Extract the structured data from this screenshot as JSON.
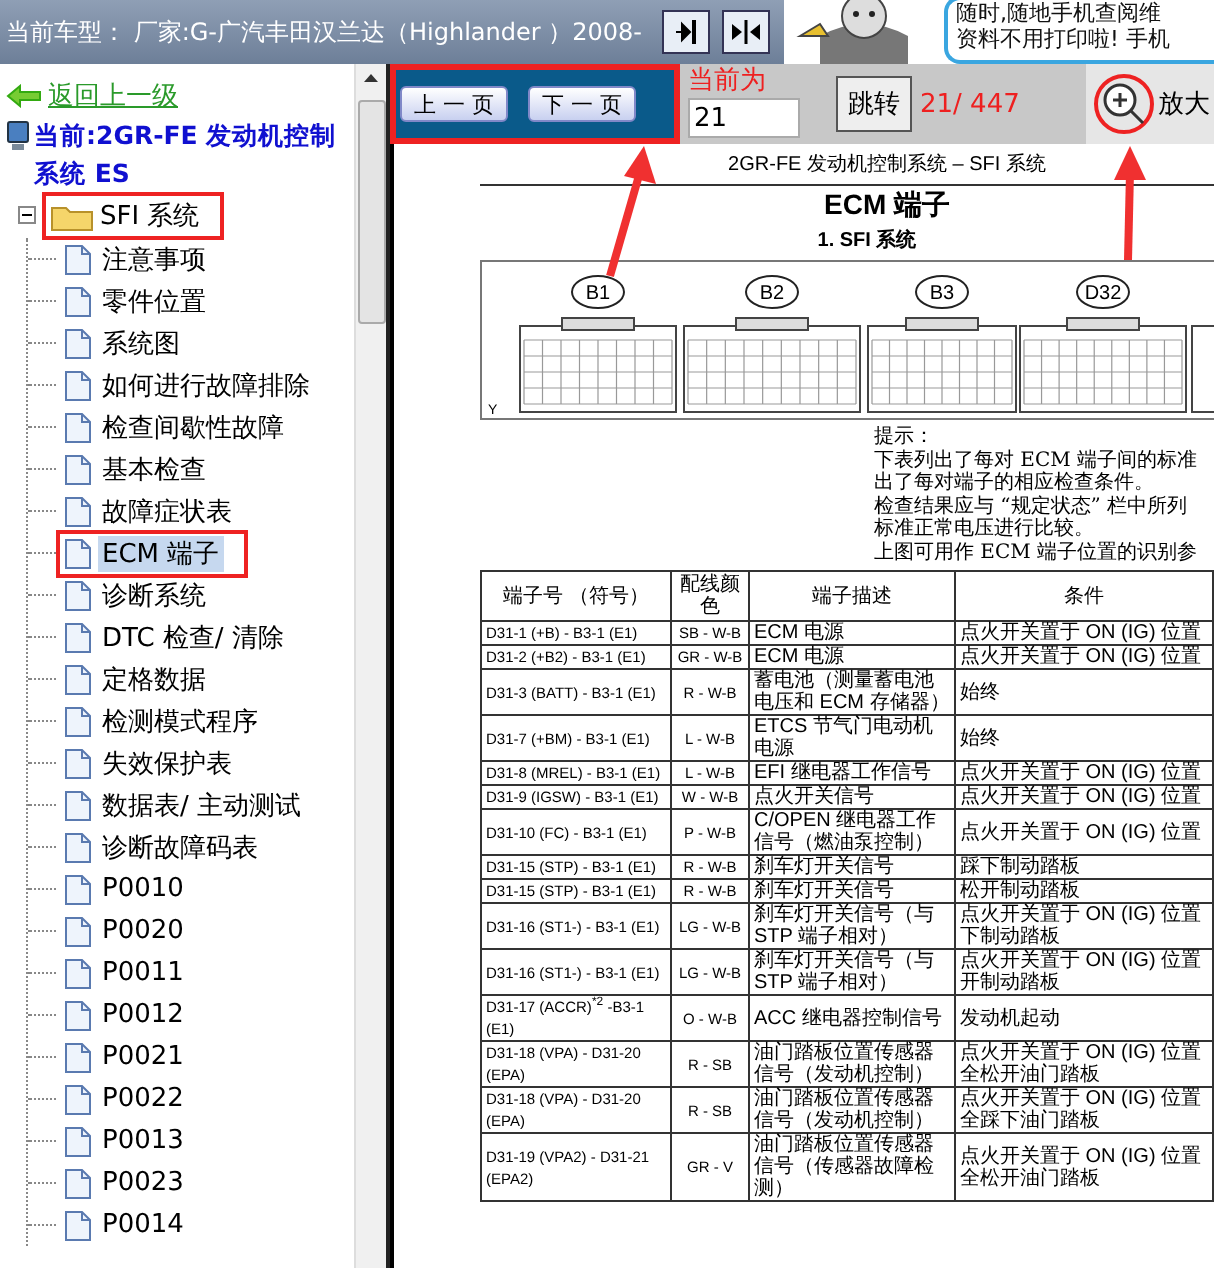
{
  "header": {
    "title": "当前车型： 厂家:G-广汽丰田汉兰达（Highlander ）2008-",
    "ad_lines": [
      "随时,随地手机查阅维",
      "资料不用打印啦! 手机"
    ]
  },
  "sidebar": {
    "back_link": "返回上一级",
    "current": "当前:2GR-FE 发动机控制系统 ES",
    "tree": [
      {
        "label": "SFI 系统",
        "expanded": true,
        "highlighted": true,
        "children": [
          {
            "label": "注意事项",
            "selected": false,
            "highlighted": false
          },
          {
            "label": "零件位置",
            "selected": false,
            "highlighted": false
          },
          {
            "label": "系统图",
            "selected": false,
            "highlighted": false
          },
          {
            "label": "如何进行故障排除",
            "selected": false,
            "highlighted": false
          },
          {
            "label": "检查间歇性故障",
            "selected": false,
            "highlighted": false
          },
          {
            "label": "基本检查",
            "selected": false,
            "highlighted": false
          },
          {
            "label": "故障症状表",
            "selected": false,
            "highlighted": false
          },
          {
            "label": "ECM 端子",
            "selected": true,
            "highlighted": true
          },
          {
            "label": "诊断系统",
            "selected": false,
            "highlighted": false
          },
          {
            "label": "DTC 检查/ 清除",
            "selected": false,
            "highlighted": false
          },
          {
            "label": "定格数据",
            "selected": false,
            "highlighted": false
          },
          {
            "label": "检测模式程序",
            "selected": false,
            "highlighted": false
          },
          {
            "label": "失效保护表",
            "selected": false,
            "highlighted": false
          },
          {
            "label": "数据表/ 主动测试",
            "selected": false,
            "highlighted": false
          },
          {
            "label": "诊断故障码表",
            "selected": false,
            "highlighted": false
          },
          {
            "label": "P0010",
            "selected": false,
            "highlighted": false
          },
          {
            "label": "P0020",
            "selected": false,
            "highlighted": false
          },
          {
            "label": "P0011",
            "selected": false,
            "highlighted": false
          },
          {
            "label": "P0012",
            "selected": false,
            "highlighted": false
          },
          {
            "label": "P0021",
            "selected": false,
            "highlighted": false
          },
          {
            "label": "P0022",
            "selected": false,
            "highlighted": false
          },
          {
            "label": "P0013",
            "selected": false,
            "highlighted": false
          },
          {
            "label": "P0023",
            "selected": false,
            "highlighted": false
          },
          {
            "label": "P0014",
            "selected": false,
            "highlighted": false
          }
        ]
      }
    ]
  },
  "toolbar": {
    "prev": "上 一 页",
    "next": "下 一 页",
    "current_label": "当前为",
    "page_input": "21",
    "jump": "跳转",
    "page_count": "21/ 447",
    "zoom": "放大"
  },
  "document": {
    "running_header": "2GR-FE 发动机控制系统 – SFI 系统",
    "title": "ECM 端子",
    "section": "1.  SFI 系统",
    "diagram": {
      "connectors": [
        "B1",
        "B2",
        "B3",
        "D32"
      ],
      "corner_mark": "Y"
    },
    "hint": [
      "提示：",
      "下表列出了每对 ECM 端子间的标准",
      "出了每对端子的相应检查条件。",
      "检查结果应与 “规定状态” 栏中所列",
      "标准正常电压进行比较。",
      "上图可用作 ECM 端子位置的识别参"
    ],
    "table": {
      "columns": [
        "端子号 （符号）",
        "配线颜色",
        "端子描述",
        "条件"
      ],
      "rows": [
        [
          "D31-1 (+B) - B3-1 (E1)",
          "SB - W-B",
          "ECM 电源",
          "点火开关置于 ON (IG) 位置"
        ],
        [
          "D31-2 (+B2) - B3-1 (E1)",
          "GR - W-B",
          "ECM 电源",
          "点火开关置于 ON (IG) 位置"
        ],
        [
          "D31-3 (BATT) - B3-1 (E1)",
          "R - W-B",
          "蓄电池（测量蓄电池电压和 ECM 存储器）",
          "始终"
        ],
        [
          "D31-7 (+BM) - B3-1 (E1)",
          "L - W-B",
          "ETCS 节气门电动机电源",
          "始终"
        ],
        [
          "D31-8 (MREL) - B3-1 (E1)",
          "L - W-B",
          "EFI 继电器工作信号",
          "点火开关置于 ON (IG) 位置"
        ],
        [
          "D31-9 (IGSW) - B3-1 (E1)",
          "W - W-B",
          "点火开关信号",
          "点火开关置于 ON (IG) 位置"
        ],
        [
          "D31-10 (FC) - B3-1 (E1)",
          "P - W-B",
          "C/OPEN 继电器工作信号（燃油泵控制）",
          "点火开关置于 ON (IG) 位置"
        ],
        [
          "D31-15 (STP) - B3-1 (E1)",
          "R - W-B",
          "刹车灯开关信号",
          "踩下制动踏板"
        ],
        [
          "D31-15 (STP) - B3-1 (E1)",
          "R - W-B",
          "刹车灯开关信号",
          "松开制动踏板"
        ],
        [
          "D31-16 (ST1-) - B3-1 (E1)",
          "LG - W-B",
          "刹车灯开关信号（与 STP 端子相对）",
          "点火开关置于 ON (IG) 位置下制动踏板"
        ],
        [
          "D31-16 (ST1-) - B3-1 (E1)",
          "LG - W-B",
          "刹车灯开关信号（与 STP 端子相对）",
          "点火开关置于 ON (IG) 位置开制动踏板"
        ],
        [
          "D31-17 (ACCR)$^{*2}$ -B3-1 (E1)",
          "O - W-B",
          "ACC 继电器控制信号",
          "发动机起动"
        ],
        [
          "D31-18 (VPA) - D31-20 (EPA)",
          "R - SB",
          "油门踏板位置传感器信号（发动机控制）",
          "点火开关置于 ON (IG) 位置全松开油门踏板"
        ],
        [
          "D31-18 (VPA) - D31-20 (EPA)",
          "R - SB",
          "油门踏板位置传感器信号（发动机控制）",
          "点火开关置于 ON (IG) 位置全踩下油门踏板"
        ],
        [
          "D31-19 (VPA2) - D31-21 (EPA2)",
          "GR - V",
          "油门踏板位置传感器信号（传感器故障检测）",
          "点火开关置于 ON (IG) 位置全松开油门踏板"
        ]
      ]
    }
  }
}
